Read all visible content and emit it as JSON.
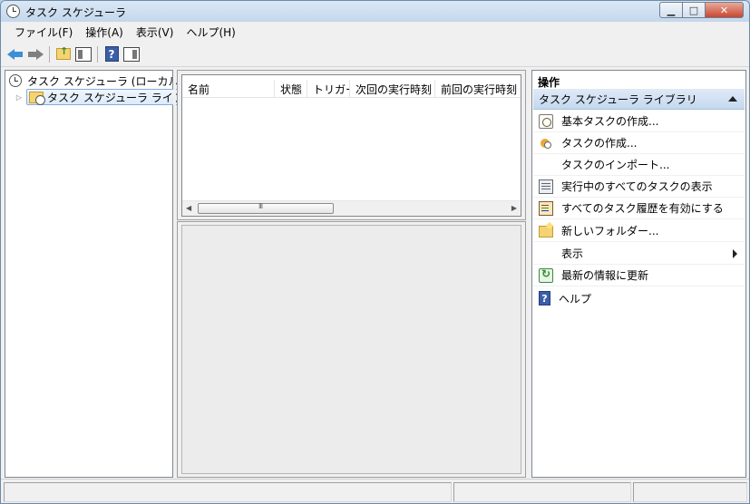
{
  "window": {
    "title": "タスク スケジューラ"
  },
  "menu": [
    "ファイル(F)",
    "操作(A)",
    "表示(V)",
    "ヘルプ(H)"
  ],
  "tree": {
    "root_label": "タスク スケジューラ (ローカル)",
    "child_label": "タスク スケジューラ ライブラリ"
  },
  "task_list": {
    "columns": [
      "名前",
      "状態",
      "トリガー",
      "次回の実行時刻",
      "前回の実行時刻"
    ]
  },
  "actions": {
    "title": "操作",
    "section": "タスク スケジューラ ライブラリ",
    "items": [
      {
        "label": "基本タスクの作成...",
        "icon": "wizard-icon"
      },
      {
        "label": "タスクの作成...",
        "icon": "task-icon"
      },
      {
        "label": "タスクのインポート...",
        "icon": ""
      },
      {
        "label": "実行中のすべてのタスクの表示",
        "icon": "running-tasks-icon"
      },
      {
        "label": "すべてのタスク履歴を有効にする",
        "icon": "history-icon"
      },
      {
        "label": "新しいフォルダー...",
        "icon": "folder-icon"
      },
      {
        "label": "表示",
        "icon": ""
      },
      {
        "label": "最新の情報に更新",
        "icon": "refresh-icon"
      },
      {
        "label": "ヘルプ",
        "icon": "help-icon"
      }
    ]
  },
  "titlebar_buttons": {
    "minimize": "▁",
    "maximize": "□",
    "close": "✕"
  },
  "help_glyph": "?"
}
